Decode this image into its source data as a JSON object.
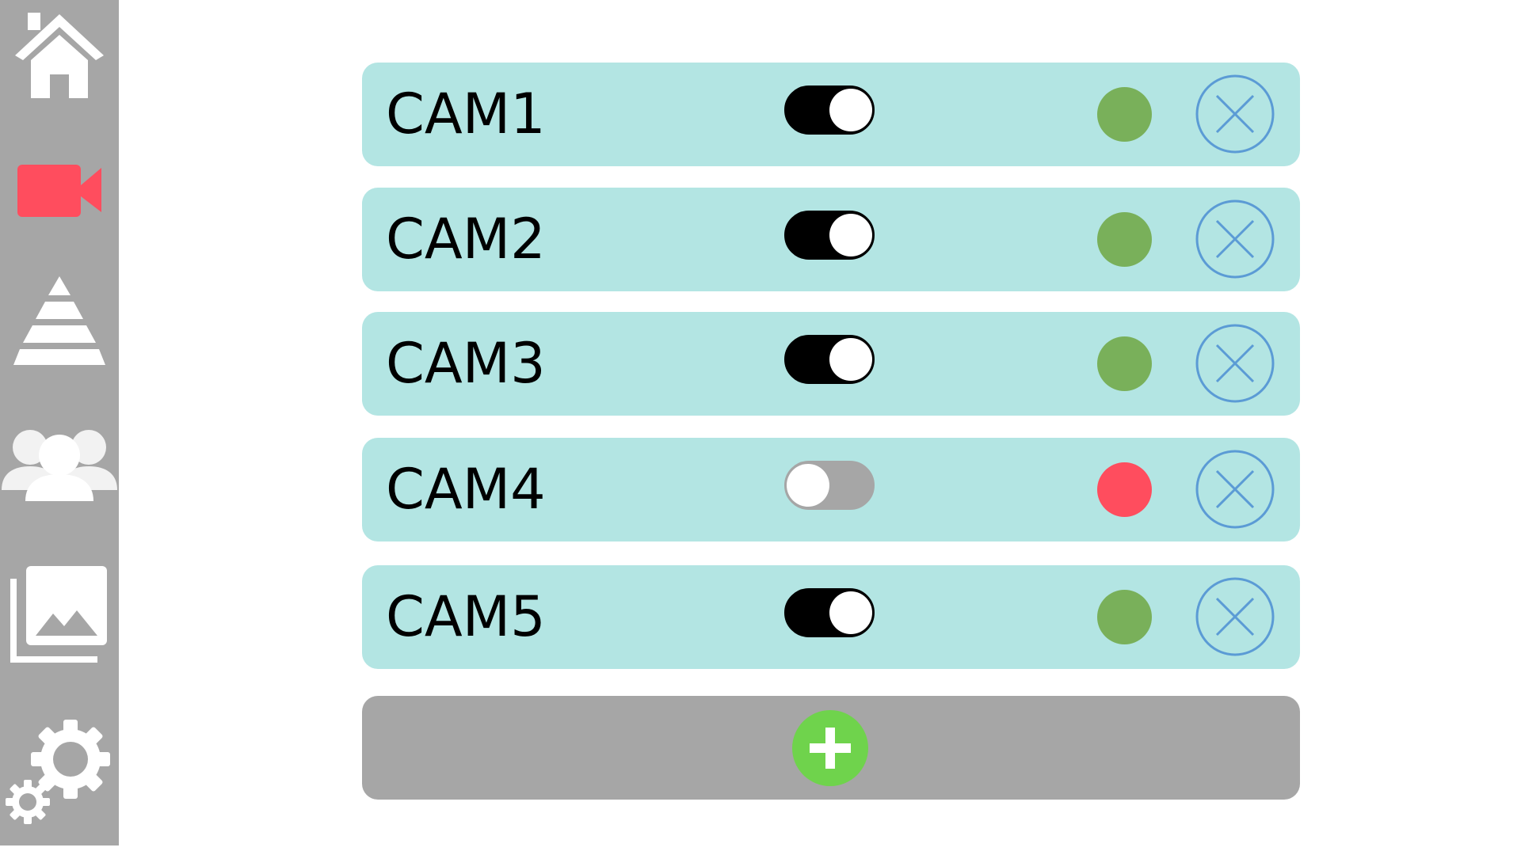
{
  "sidebar": {
    "items": [
      {
        "name": "home",
        "icon": "home-icon",
        "color": "#ffffff"
      },
      {
        "name": "cameras",
        "icon": "video-camera-icon",
        "color": "#ff4d5e",
        "active": true
      },
      {
        "name": "layers",
        "icon": "pyramid-icon",
        "color": "#ffffff"
      },
      {
        "name": "users",
        "icon": "users-icon",
        "color": "#ffffff"
      },
      {
        "name": "gallery",
        "icon": "image-gallery-icon",
        "color": "#ffffff"
      },
      {
        "name": "settings",
        "icon": "gears-icon",
        "color": "#ffffff"
      }
    ]
  },
  "cameras": [
    {
      "label": "CAM1",
      "enabled": true,
      "status": "online",
      "status_color": "#79b05a"
    },
    {
      "label": "CAM2",
      "enabled": true,
      "status": "online",
      "status_color": "#79b05a"
    },
    {
      "label": "CAM3",
      "enabled": true,
      "status": "online",
      "status_color": "#79b05a"
    },
    {
      "label": "CAM4",
      "enabled": false,
      "status": "offline",
      "status_color": "#ff4d5e"
    },
    {
      "label": "CAM5",
      "enabled": true,
      "status": "online",
      "status_color": "#79b05a"
    }
  ],
  "add_camera": {
    "icon": "plus-icon",
    "color": "#6fd34c"
  },
  "colors": {
    "sidebar_bg": "#a6a6a6",
    "row_bg": "#b3e5e3",
    "remove_icon": "#5b9bd5",
    "add_row_bg": "#a6a6a6"
  }
}
